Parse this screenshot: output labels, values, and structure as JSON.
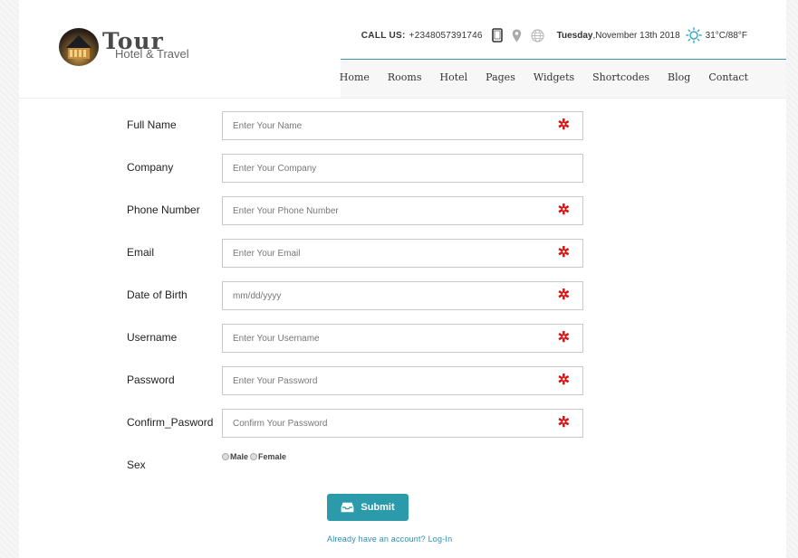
{
  "header": {
    "logo_title": "Tour",
    "logo_subtitle": "Hotel & Travel",
    "call_label": "CALL US:",
    "phone": "+2348057391746",
    "day": "Tuesday",
    "date": ",November 13th 2018",
    "temperature": "31°C/88°F",
    "icons": [
      "tablet-icon",
      "map-pin-icon",
      "globe-icon",
      "sun-icon"
    ]
  },
  "nav": {
    "items": [
      {
        "label": "Home"
      },
      {
        "label": "Rooms"
      },
      {
        "label": "Hotel"
      },
      {
        "label": "Pages"
      },
      {
        "label": "Widgets"
      },
      {
        "label": "Shortcodes"
      },
      {
        "label": "Blog"
      },
      {
        "label": "Contact"
      }
    ]
  },
  "form": {
    "fields": [
      {
        "label": "Full Name",
        "placeholder": "Enter Your Name",
        "value": "",
        "required": true
      },
      {
        "label": "Company",
        "placeholder": "Enter Your Company",
        "value": "",
        "required": false
      },
      {
        "label": "Phone Number",
        "placeholder": "Enter Your Phone Number",
        "value": "",
        "required": true
      },
      {
        "label": "Email",
        "placeholder": "Enter Your Email",
        "value": "",
        "required": true
      },
      {
        "label": "Date of Birth",
        "placeholder": "mm/dd/yyyy",
        "value": "",
        "required": true
      },
      {
        "label": "Username",
        "placeholder": "Enter Your Username",
        "value": "",
        "required": true
      },
      {
        "label": "Password",
        "placeholder": "Enter Your Password",
        "value": "",
        "required": true
      },
      {
        "label": "Confirm_Pasword",
        "placeholder": "Confirm Your Password",
        "value": "",
        "required": true
      }
    ],
    "required_mark": "✲",
    "sex_label": "Sex",
    "sex_options": [
      {
        "label": "Male"
      },
      {
        "label": "Female"
      }
    ],
    "submit_label": "Submit",
    "login_link": "Already have an account? Log-In"
  },
  "colors": {
    "accent": "#2b9aab",
    "required": "#e01010",
    "link": "#2b8fb0"
  }
}
